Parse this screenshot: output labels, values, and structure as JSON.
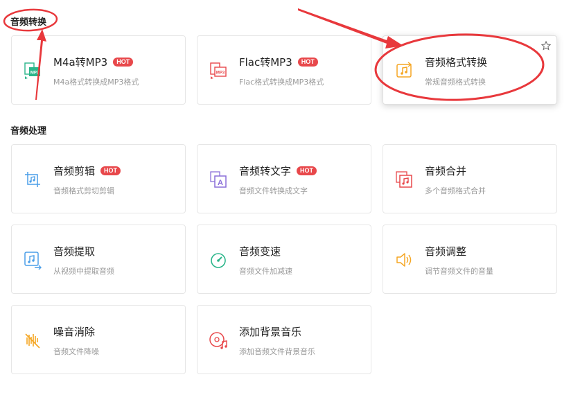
{
  "sections": [
    {
      "title": "音频转换",
      "cards": [
        {
          "title": "M4a转MP3",
          "desc": "M4a格式转换成MP3格式",
          "hot": "HOT",
          "icon": "m4a-to-mp3-icon"
        },
        {
          "title": "Flac转MP3",
          "desc": "Flac格式转换成MP3格式",
          "hot": "HOT",
          "icon": "flac-to-mp3-icon"
        },
        {
          "title": "音频格式转换",
          "desc": "常规音频格式转换",
          "icon": "audio-format-convert-icon"
        }
      ]
    },
    {
      "title": "音频处理",
      "cards": [
        {
          "title": "音频剪辑",
          "desc": "音频格式剪切剪辑",
          "hot": "HOT",
          "icon": "audio-cut-icon"
        },
        {
          "title": "音频转文字",
          "desc": "音频文件转换成文字",
          "hot": "HOT",
          "icon": "audio-to-text-icon"
        },
        {
          "title": "音频合并",
          "desc": "多个音频格式合并",
          "icon": "audio-merge-icon"
        },
        {
          "title": "音频提取",
          "desc": "从视频中提取音频",
          "icon": "audio-extract-icon"
        },
        {
          "title": "音频变速",
          "desc": "音频文件加减速",
          "icon": "audio-speed-icon"
        },
        {
          "title": "音频调整",
          "desc": "调节音频文件的音量",
          "icon": "volume-icon"
        },
        {
          "title": "噪音消除",
          "desc": "音频文件降噪",
          "icon": "noise-reduction-icon"
        },
        {
          "title": "添加背景音乐",
          "desc": "添加音频文件背景音乐",
          "icon": "background-music-icon"
        }
      ]
    }
  ],
  "icon_labels": {
    "mp3": "MP3",
    "text": "A"
  },
  "colors": {
    "hot": "#e8484b",
    "annotation": "#e8383c",
    "green": "#2bb58a",
    "orange": "#f5a623",
    "blue": "#4a9ee8",
    "purple": "#8a6fd8",
    "red": "#e8484b"
  }
}
